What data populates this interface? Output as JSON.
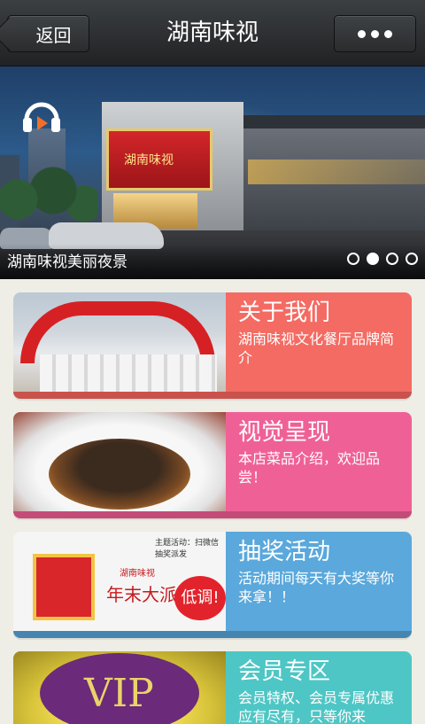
{
  "header": {
    "back_label": "返回",
    "title": "湖南味视",
    "more_icon": "ellipsis-icon"
  },
  "banner": {
    "caption": "湖南味视美丽夜景",
    "storefront_text": "湖南味视",
    "audio_icon": "headphones-play-icon",
    "pagination": {
      "count": 4,
      "active_index": 1
    }
  },
  "cards": [
    {
      "title": "关于我们",
      "desc": "湖南味视文化餐厅品牌简介",
      "color": "#f36b63"
    },
    {
      "title": "视觉呈现",
      "desc": "本店菜品介绍，欢迎品尝！",
      "color": "#ef6196"
    },
    {
      "title": "抽奖活动",
      "desc": "活动期间每天有大奖等你来拿！！",
      "color": "#5aa8dc",
      "image_text": {
        "brand": "湖南味视",
        "headline": "年末大派发",
        "bubble": "低调!",
        "sub": "主题活动：扫微信 抽奖派发"
      }
    },
    {
      "title": "会员专区",
      "desc": "会员特权、会员专属优惠应有尽有，只等你来",
      "color": "#4ec6c5",
      "image_text": {
        "badge": "VIP"
      }
    }
  ]
}
